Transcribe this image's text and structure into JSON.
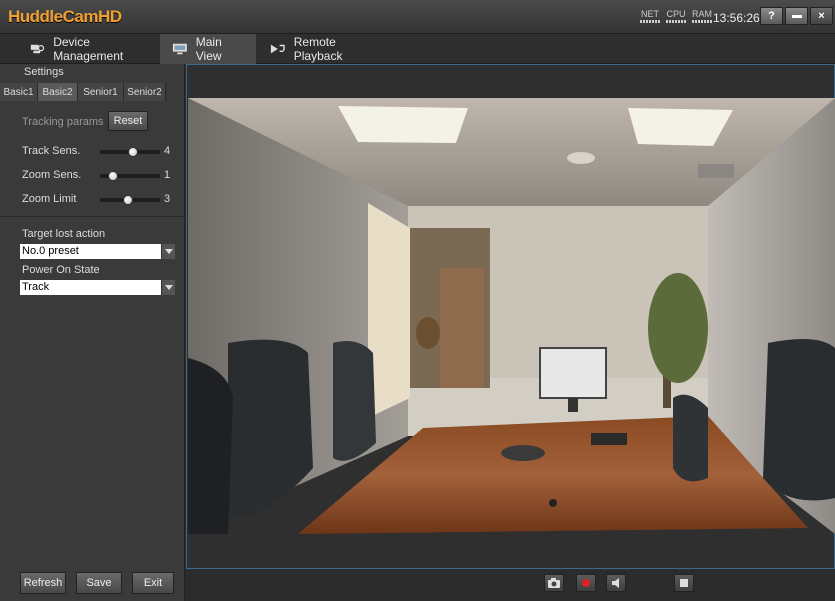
{
  "app": {
    "title": "HuddleCamHD",
    "clock": "13:56:26",
    "meters": [
      "NET",
      "CPU",
      "RAM"
    ],
    "help_label": "?",
    "close_label": "×"
  },
  "nav": {
    "tabs": [
      {
        "label": "Device Management",
        "icon": "device-management-icon"
      },
      {
        "label": "Main View",
        "icon": "monitor-icon"
      },
      {
        "label": "Remote Playback",
        "icon": "playback-icon"
      }
    ],
    "active": "Main View"
  },
  "settings": {
    "title": "Settings",
    "subtabs": [
      "Basic1",
      "Basic2",
      "Senior1",
      "Senior2"
    ],
    "active_subtab": "Basic2",
    "tracking_params_label": "Tracking params",
    "reset_label": "Reset",
    "sliders": [
      {
        "label": "Track Sens.",
        "value": "4",
        "level": 0.55
      },
      {
        "label": "Zoom Sens.",
        "value": "1",
        "level": 0.15
      },
      {
        "label": "Zoom Limit",
        "value": "3",
        "level": 0.45
      }
    ],
    "target_lost_label": "Target lost action",
    "target_lost_value": "No.0 preset",
    "power_on_label": "Power On State",
    "power_on_value": "Track"
  },
  "footer": {
    "refresh_label": "Refresh",
    "save_label": "Save",
    "exit_label": "Exit"
  },
  "controls": {
    "icons": [
      "camera-icon",
      "record-icon",
      "speaker-icon",
      "stop-icon"
    ],
    "record_color": "#e02020"
  },
  "colors": {
    "brand": "#f0a030",
    "video_border": "#3c6a8a"
  }
}
